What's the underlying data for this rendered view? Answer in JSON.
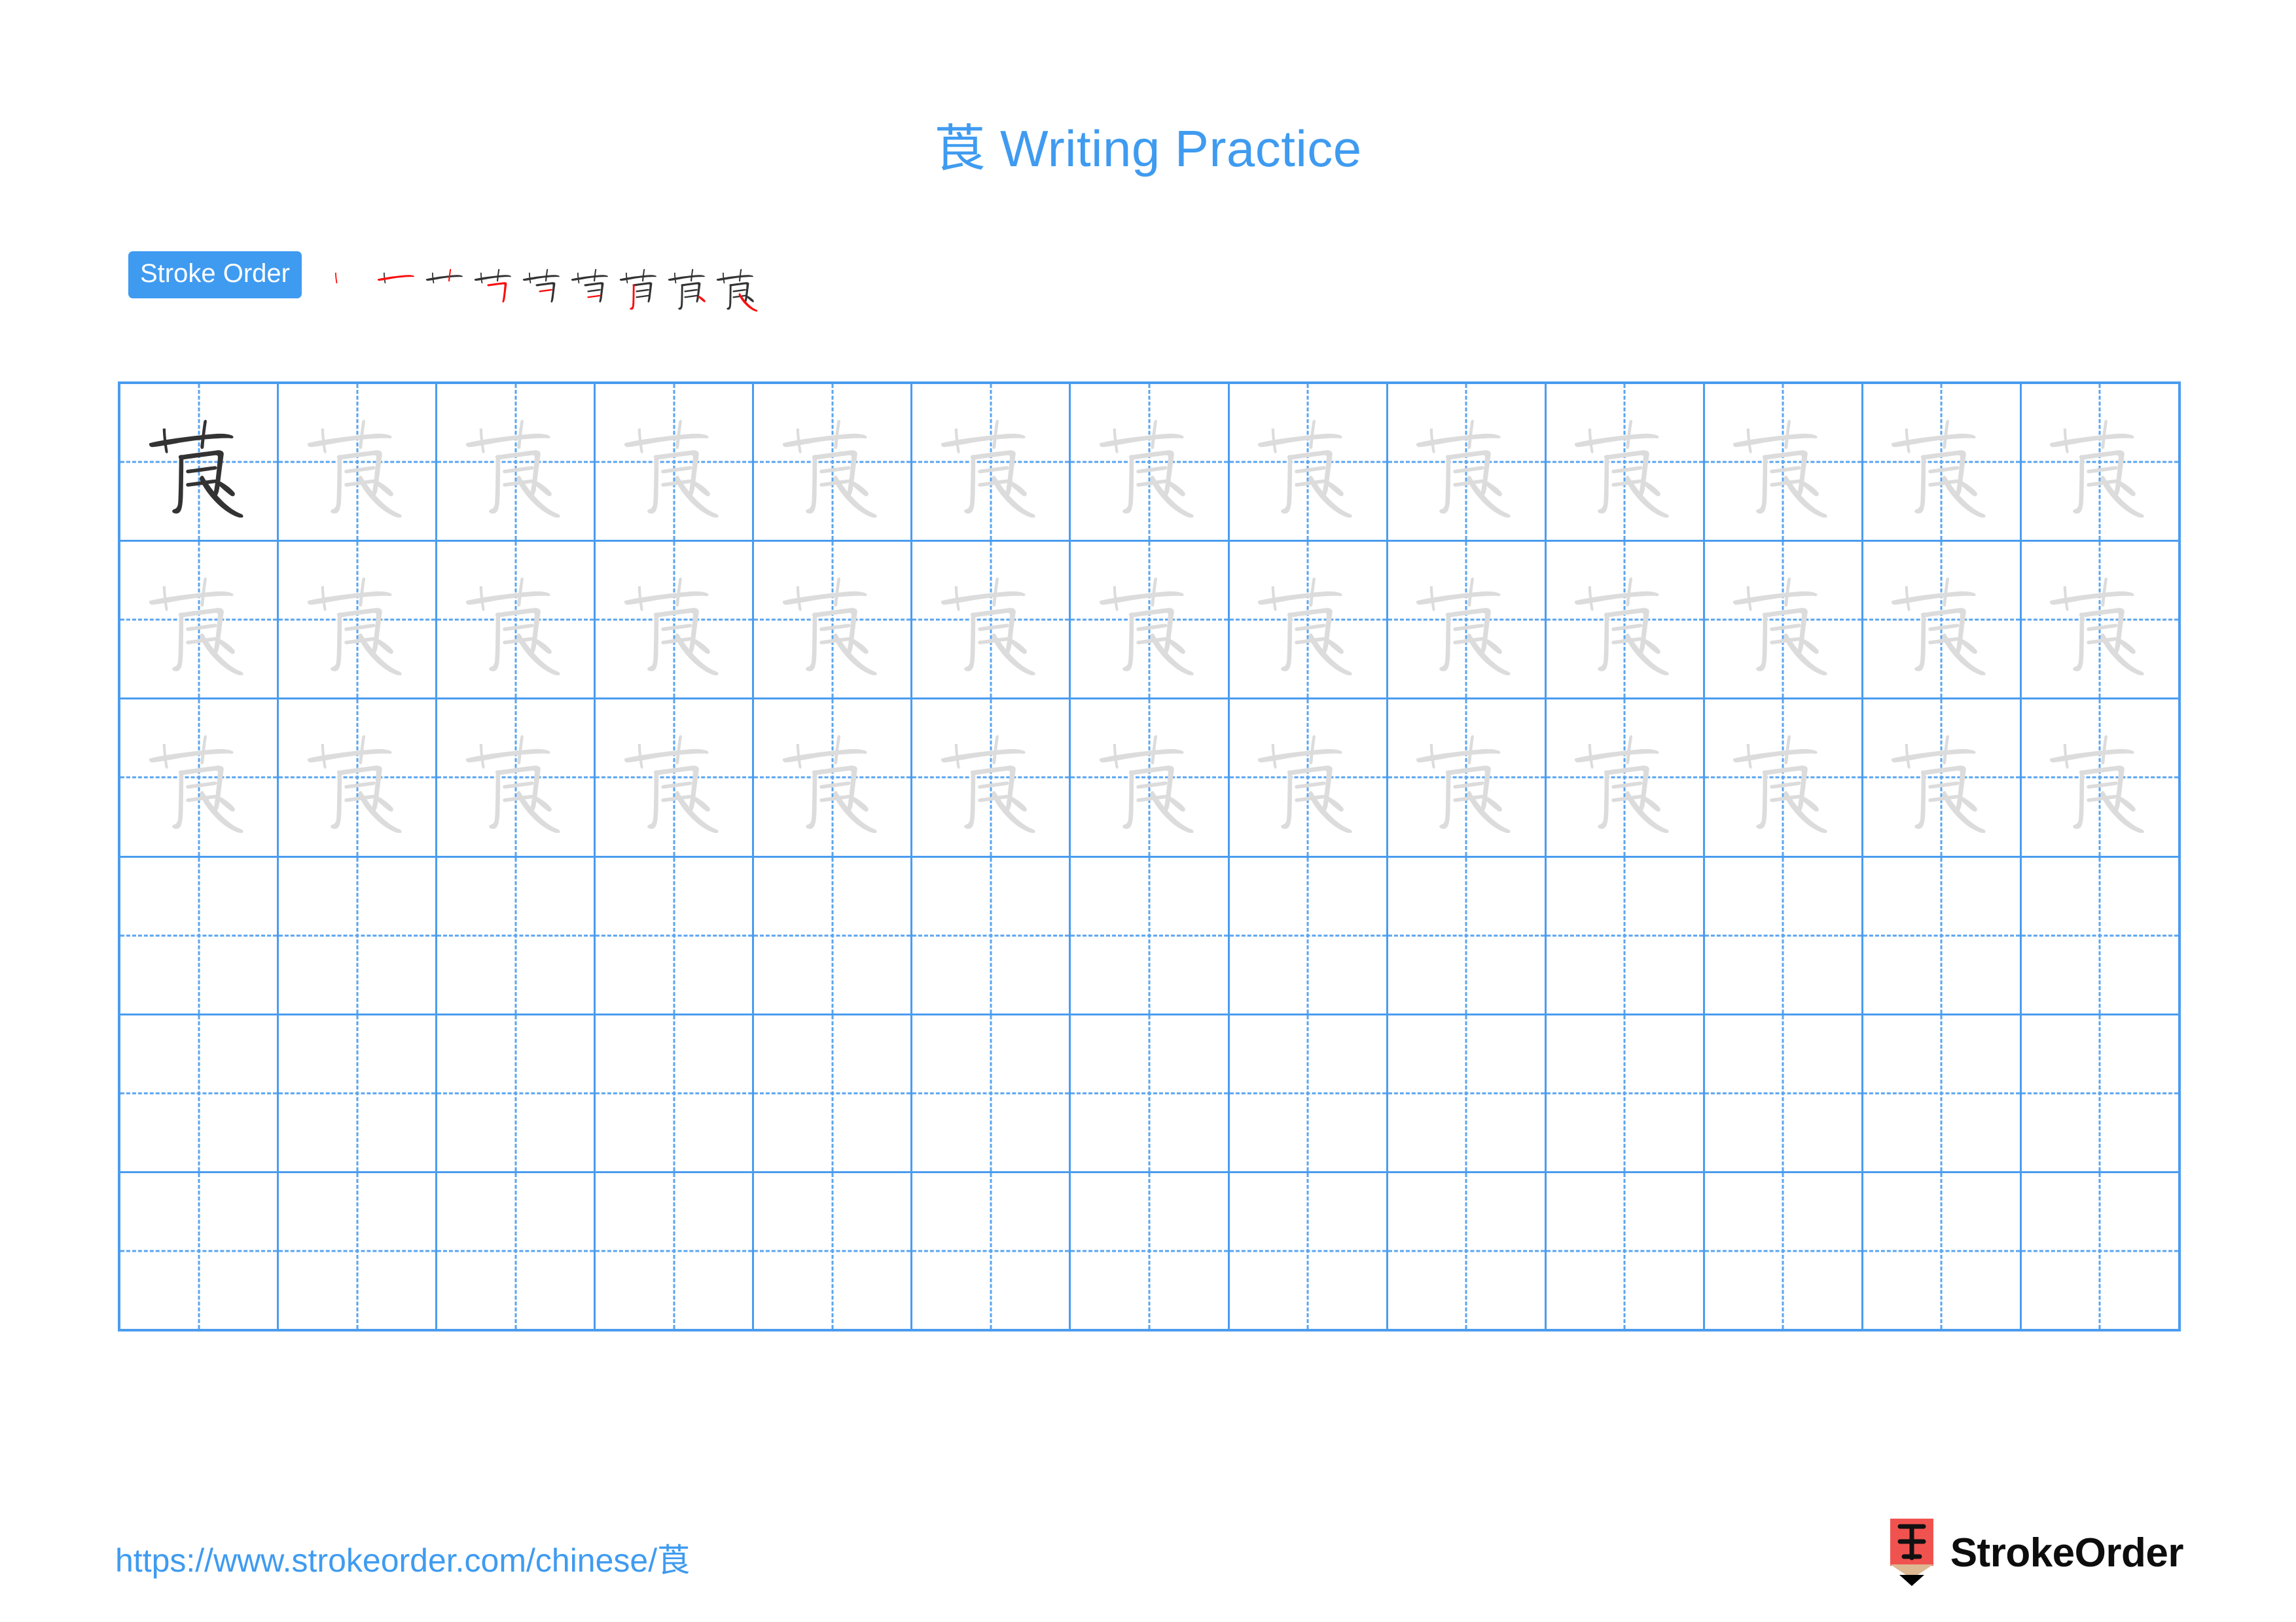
{
  "page": {
    "character": "莨",
    "title": "莨 Writing Practice",
    "title_prefix": "莨",
    "title_suffix": " Writing Practice"
  },
  "stroke_order": {
    "badge_label": "Stroke Order",
    "stroke_count": 9,
    "new_stroke_color": "#fa0f0f",
    "existing_stroke_color": "#333333",
    "steps": [
      {
        "index": 1,
        "partial": "一",
        "new_stroke": "horizontal"
      },
      {
        "index": 2,
        "partial": "十",
        "new_stroke": "vertical-left"
      },
      {
        "index": 3,
        "partial": "艹",
        "new_stroke": "vertical-right"
      },
      {
        "index": 4,
        "partial": "艼",
        "new_stroke": "horizontal-fold-hook"
      },
      {
        "index": 5,
        "partial": "苧",
        "new_stroke": "horizontal-inner-1"
      },
      {
        "index": 6,
        "partial": "苜",
        "new_stroke": "horizontal-inner-2"
      },
      {
        "index": 7,
        "partial": "苜",
        "new_stroke": "long-vertical"
      },
      {
        "index": 8,
        "partial": "莨",
        "new_stroke": "short-press"
      },
      {
        "index": 9,
        "partial": "莨",
        "new_stroke": "right-falling"
      }
    ]
  },
  "grid": {
    "columns": 13,
    "rows": 6,
    "line_color": "#4a9cef",
    "guide_color": "#5aa5f0",
    "model_char_color": "#333333",
    "trace_char_color": "#dcdcdc",
    "rows_data": [
      {
        "row": 1,
        "cells": [
          "model",
          "trace",
          "trace",
          "trace",
          "trace",
          "trace",
          "trace",
          "trace",
          "trace",
          "trace",
          "trace",
          "trace",
          "trace"
        ]
      },
      {
        "row": 2,
        "cells": [
          "trace",
          "trace",
          "trace",
          "trace",
          "trace",
          "trace",
          "trace",
          "trace",
          "trace",
          "trace",
          "trace",
          "trace",
          "trace"
        ]
      },
      {
        "row": 3,
        "cells": [
          "trace",
          "trace",
          "trace",
          "trace",
          "trace",
          "trace",
          "trace",
          "trace",
          "trace",
          "trace",
          "trace",
          "trace",
          "trace"
        ]
      },
      {
        "row": 4,
        "cells": [
          "empty",
          "empty",
          "empty",
          "empty",
          "empty",
          "empty",
          "empty",
          "empty",
          "empty",
          "empty",
          "empty",
          "empty",
          "empty"
        ]
      },
      {
        "row": 5,
        "cells": [
          "empty",
          "empty",
          "empty",
          "empty",
          "empty",
          "empty",
          "empty",
          "empty",
          "empty",
          "empty",
          "empty",
          "empty",
          "empty"
        ]
      },
      {
        "row": 6,
        "cells": [
          "empty",
          "empty",
          "empty",
          "empty",
          "empty",
          "empty",
          "empty",
          "empty",
          "empty",
          "empty",
          "empty",
          "empty",
          "empty"
        ]
      }
    ]
  },
  "footer": {
    "url": "https://www.strokeorder.com/chinese/莨",
    "brand_name": "StrokeOrder",
    "brand_mark_char": "字",
    "brand_mark_color": "#f0534f",
    "brand_mark_tip_color": "#ddb892"
  },
  "colors": {
    "accent_blue": "#3f9bf0",
    "grid_blue": "#4a9cef",
    "stroke_red": "#fa0f0f",
    "ink_black": "#333333",
    "trace_gray": "#dcdcdc"
  }
}
